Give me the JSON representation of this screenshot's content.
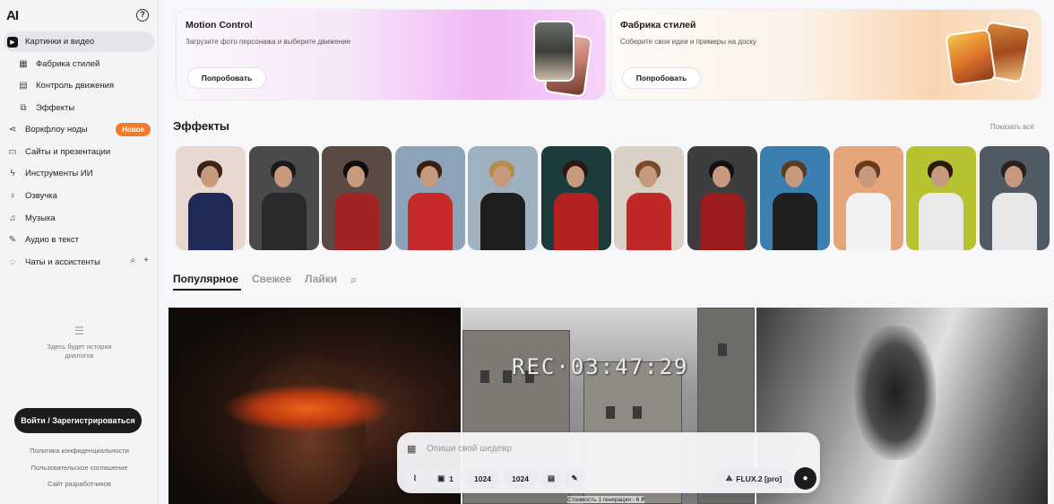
{
  "sidebar": {
    "logo": "AI",
    "help_icon": "?",
    "items": [
      {
        "label": "Картинки и видео",
        "icon": "play-square-icon"
      },
      {
        "label": "Фабрика стилей",
        "icon": "palette-icon"
      },
      {
        "label": "Контроль движения",
        "icon": "film-icon"
      },
      {
        "label": "Эффекты",
        "icon": "effects-icon"
      },
      {
        "label": "Воркфлоу ноды",
        "icon": "share-nodes-icon",
        "badge": "Новое"
      },
      {
        "label": "Сайты и презентации",
        "icon": "window-icon"
      },
      {
        "label": "Инструменты ИИ",
        "icon": "lightning-icon"
      },
      {
        "label": "Озвучка",
        "icon": "microphone-icon"
      },
      {
        "label": "Музыка",
        "icon": "music-note-icon"
      },
      {
        "label": "Аудио в текст",
        "icon": "wand-icon"
      },
      {
        "label": "Чаты и ассистенты",
        "icon": "chat-bubble-icon"
      }
    ],
    "history_text": "Здесь будет история диалогов",
    "login_button": "Войти / Зарегистрироваться",
    "links": [
      "Политика конфиденциальности",
      "Пользовательское соглашение",
      "Сайт разработчиков"
    ]
  },
  "promos": [
    {
      "title": "Motion Control",
      "desc": "Загрузите фото персонажа и выберите движение",
      "button": "Попробовать"
    },
    {
      "title": "Фабрика стилей",
      "desc": "Соберите свои идеи и примеры на доску",
      "button": "Попробовать"
    }
  ],
  "effects": {
    "title": "Эффекты",
    "show_all": "Показать всё",
    "thumbs": [
      {
        "bg": "#e8d8cf",
        "hair": "#3a2418",
        "body": "#1f2b56"
      },
      {
        "bg": "#4a4a4a",
        "hair": "#1a1a1a",
        "body": "#2a2a2a"
      },
      {
        "bg": "#5b4a44",
        "hair": "#120c0a",
        "body": "#a02424"
      },
      {
        "bg": "#8da3b8",
        "hair": "#3a2014",
        "body": "#c62a2a"
      },
      {
        "bg": "#9fb0bf",
        "hair": "#b58a4a",
        "body": "#1e1e1e"
      },
      {
        "bg": "#1b3c3a",
        "hair": "#2a1810",
        "body": "#b32020"
      },
      {
        "bg": "#d9d0c6",
        "hair": "#7a4a2a",
        "body": "#c02828"
      },
      {
        "bg": "#3d3d3d",
        "hair": "#111111",
        "body": "#9a1c1c"
      },
      {
        "bg": "#3a7fb0",
        "hair": "#5a3a20",
        "body": "#1f1f1f"
      },
      {
        "bg": "#e4a57a",
        "hair": "#6a3a1a",
        "body": "#f2f2f2"
      },
      {
        "bg": "#b6c230",
        "hair": "#2a1a10",
        "body": "#e9e9e9"
      },
      {
        "bg": "#4f5a62",
        "hair": "#2a2018",
        "body": "#e8e8e8"
      }
    ]
  },
  "tabs": [
    "Популярное",
    "Свежее",
    "Лайки"
  ],
  "gallery": {
    "overlay_text": "REC·03:47:29"
  },
  "prompt": {
    "placeholder": "Опиши свой шедевр",
    "count": "1",
    "width": "1024",
    "height": "1024",
    "model": "FLUX.2 [pro]",
    "cost": "Стоимость 1 генерации - 6 ₽"
  }
}
